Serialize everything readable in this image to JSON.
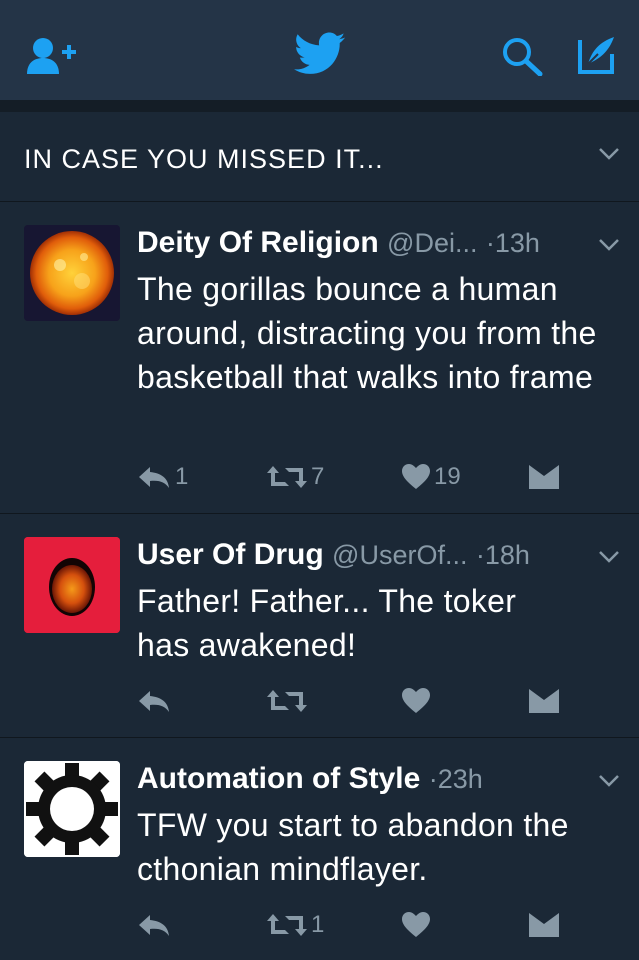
{
  "colors": {
    "accent": "#1da1f2",
    "background": "#1b2836",
    "navbar": "#243447",
    "muted": "#8899a6"
  },
  "navbar": {
    "icons": [
      "add-user-icon",
      "twitter-bird-icon",
      "search-icon",
      "compose-tweet-icon"
    ]
  },
  "section": {
    "title": "IN CASE YOU MISSED IT..."
  },
  "tweets": [
    {
      "name": "Deity Of Religion",
      "handle": "@Dei...",
      "time": "13h",
      "text": "The gorillas bounce a human around, distracting you from the basketball that walks into frame",
      "replies": "1",
      "retweets": "7",
      "likes": "19",
      "avatar": "sun-avatar"
    },
    {
      "name": "User Of Drug",
      "handle": "@UserOf...",
      "time": "18h",
      "text": "Father! Father... The toker has awakened!",
      "replies": "",
      "retweets": "",
      "likes": "",
      "avatar": "egg-sun-avatar"
    },
    {
      "name": "Automation of Style",
      "handle": "",
      "time": "23h",
      "text": "TFW you start to abandon the cthonian mindflayer.",
      "replies": "",
      "retweets": "1",
      "likes": "",
      "avatar": "gear-avatar"
    }
  ]
}
